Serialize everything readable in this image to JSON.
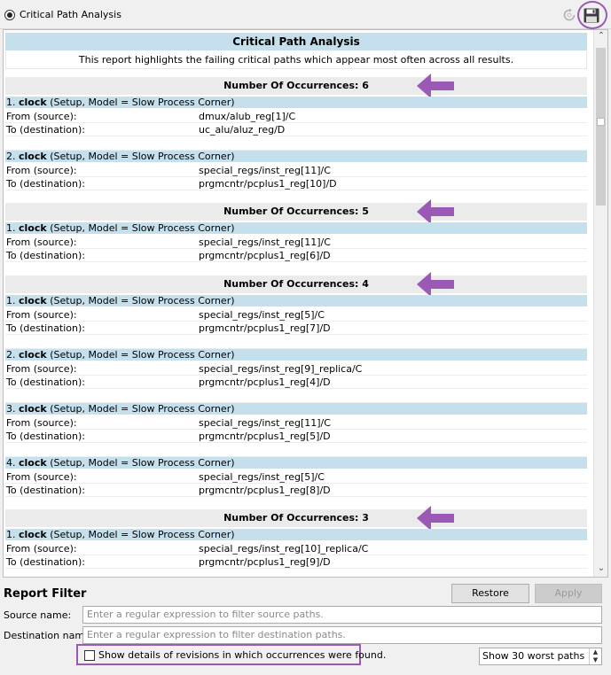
{
  "window": {
    "title": "Critical Path Analysis"
  },
  "report": {
    "title": "Critical Path Analysis",
    "description": "This report highlights the failing critical paths which appear most often across all results.",
    "from_label": "From (source):",
    "to_label": "To (destination):",
    "clock_label": "clock",
    "model_text": "(Setup, Model = Slow Process Corner)",
    "groups": [
      {
        "header": "Number Of Occurrences: 6",
        "paths": [
          {
            "index": "1.",
            "from": "dmux/alub_reg[1]/C",
            "to": "uc_alu/aluz_reg/D"
          },
          {
            "index": "2.",
            "from": "special_regs/inst_reg[11]/C",
            "to": "prgmcntr/pcplus1_reg[10]/D"
          }
        ]
      },
      {
        "header": "Number Of Occurrences: 5",
        "paths": [
          {
            "index": "1.",
            "from": "special_regs/inst_reg[11]/C",
            "to": "prgmcntr/pcplus1_reg[6]/D"
          }
        ]
      },
      {
        "header": "Number Of Occurrences: 4",
        "paths": [
          {
            "index": "1.",
            "from": "special_regs/inst_reg[5]/C",
            "to": "prgmcntr/pcplus1_reg[7]/D"
          },
          {
            "index": "2.",
            "from": "special_regs/inst_reg[9]_replica/C",
            "to": "prgmcntr/pcplus1_reg[4]/D"
          },
          {
            "index": "3.",
            "from": "special_regs/inst_reg[11]/C",
            "to": "prgmcntr/pcplus1_reg[5]/D"
          },
          {
            "index": "4.",
            "from": "special_regs/inst_reg[5]/C",
            "to": "prgmcntr/pcplus1_reg[8]/D"
          }
        ]
      },
      {
        "header": "Number Of Occurrences: 3",
        "paths": [
          {
            "index": "1.",
            "from": "special_regs/inst_reg[10]_replica/C",
            "to": "prgmcntr/pcplus1_reg[9]/D"
          }
        ]
      }
    ]
  },
  "filter": {
    "title": "Report Filter",
    "restore_label": "Restore Defaults",
    "apply_label": "Apply",
    "source_label": "Source name:",
    "source_placeholder": "Enter a regular expression to filter source paths.",
    "dest_label": "Destination name:",
    "dest_placeholder": "Enter a regular expression to filter destination paths.",
    "details_checkbox_label": "Show details of revisions in which occurrences were found.",
    "details_checked": false,
    "worst_paths_selected": "Show 30 worst paths"
  },
  "colors": {
    "accent_highlight": "#9b59b6",
    "path_header_bg": "#c5e0ec",
    "occurrence_header_bg": "#ebebeb"
  },
  "icons": {
    "title_radio": "radio-selected-icon",
    "refresh": "refresh-icon",
    "save": "save-icon",
    "occurrence_marker": "arrow-left-icon"
  }
}
